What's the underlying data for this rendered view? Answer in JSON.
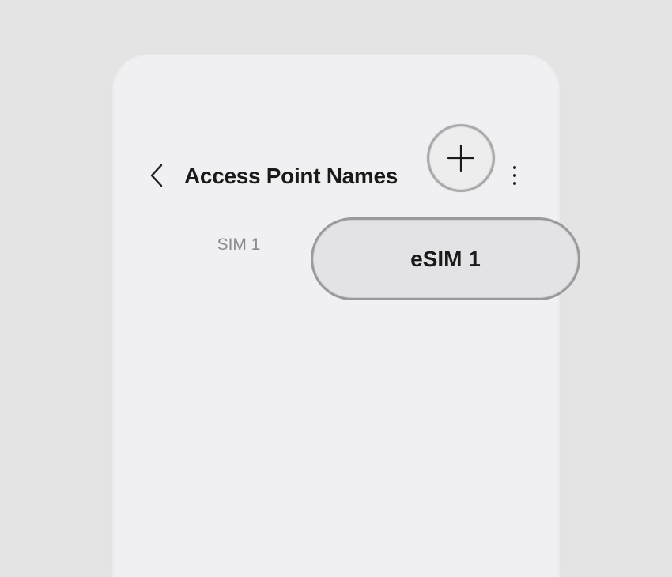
{
  "header": {
    "title": "Access Point Names",
    "back_icon": "chevron-left-icon",
    "add_icon": "plus-icon",
    "more_icon": "more-vertical-icon"
  },
  "tabs": [
    {
      "label": "SIM 1",
      "selected": false
    },
    {
      "label": "eSIM 1",
      "selected": true
    }
  ],
  "colors": {
    "background": "#e4e4e4",
    "screen": "#f0f0f2",
    "selected_tab": "#e3e3e5",
    "unselected_tab_text": "#8a8a8c"
  }
}
